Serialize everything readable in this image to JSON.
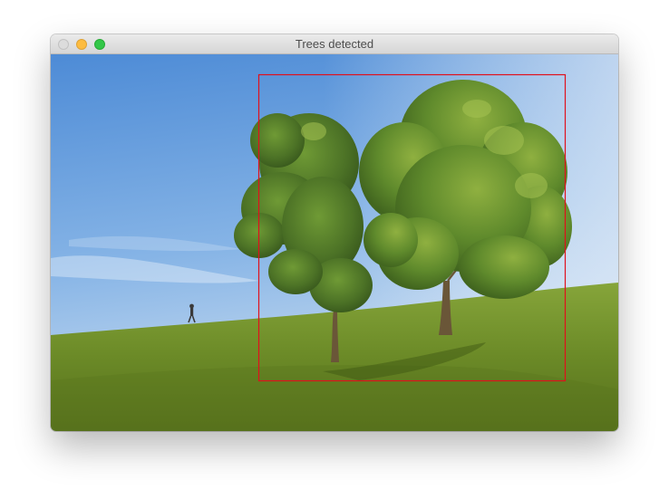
{
  "window": {
    "title": "Trees detected"
  },
  "controls": {
    "close_icon": "close-icon",
    "minimize_icon": "minimize-icon",
    "zoom_icon": "zoom-icon"
  },
  "image": {
    "detection": {
      "box_color": "#e0101c"
    }
  },
  "colors": {
    "sky_top": "#4f8ed8",
    "sky_bottom": "#c9dcef",
    "grass": "#6f8f2a",
    "foliage": "#4f7424"
  }
}
